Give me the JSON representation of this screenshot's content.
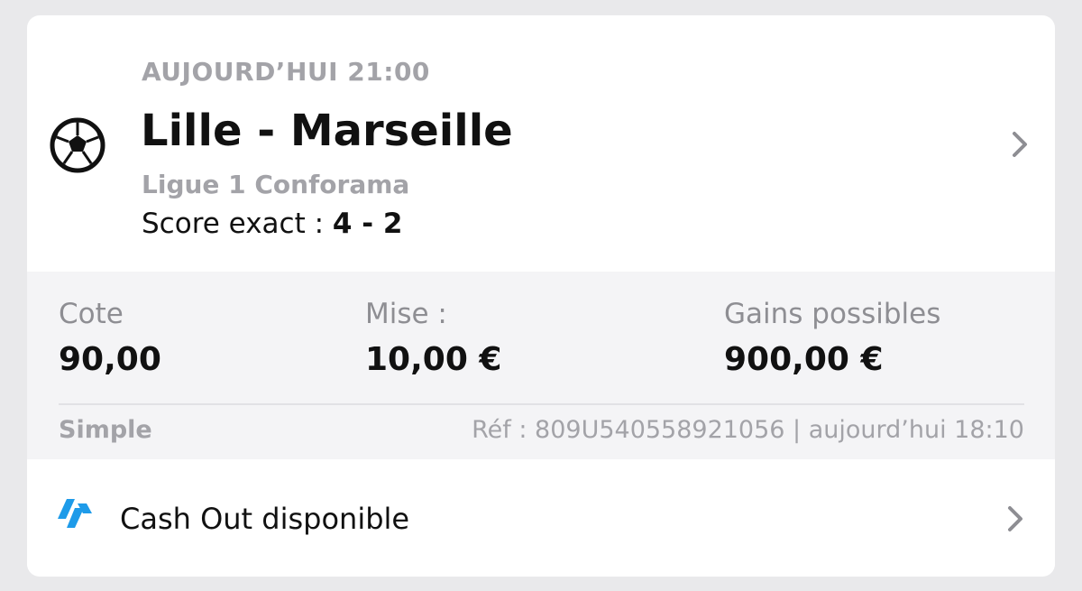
{
  "event": {
    "time": "AUJOURD’HUI 21:00",
    "match": "Lille - Marseille",
    "competition": "Ligue 1 Conforama",
    "selection_label": "Score exact : ",
    "selection_value": "4 - 2",
    "sport_icon": "soccer-ball-icon"
  },
  "stats": {
    "cote_label": "Cote",
    "cote_value": "90,00",
    "mise_label": "Mise :",
    "mise_value": "10,00 €",
    "gains_label": "Gains possibles",
    "gains_value": "900,00 €"
  },
  "footer": {
    "bet_type": "Simple",
    "ref": "Réf : 809U540558921056 | aujourd’hui 18:10"
  },
  "cashout": {
    "label": "Cash Out disponible",
    "icon": "cashout-icon",
    "accent_color": "#1e9be9"
  },
  "colors": {
    "background": "#e9e9eb",
    "card": "#ffffff",
    "stats_background": "#f4f4f6",
    "muted_text": "#a3a3a8",
    "text": "#111111"
  }
}
